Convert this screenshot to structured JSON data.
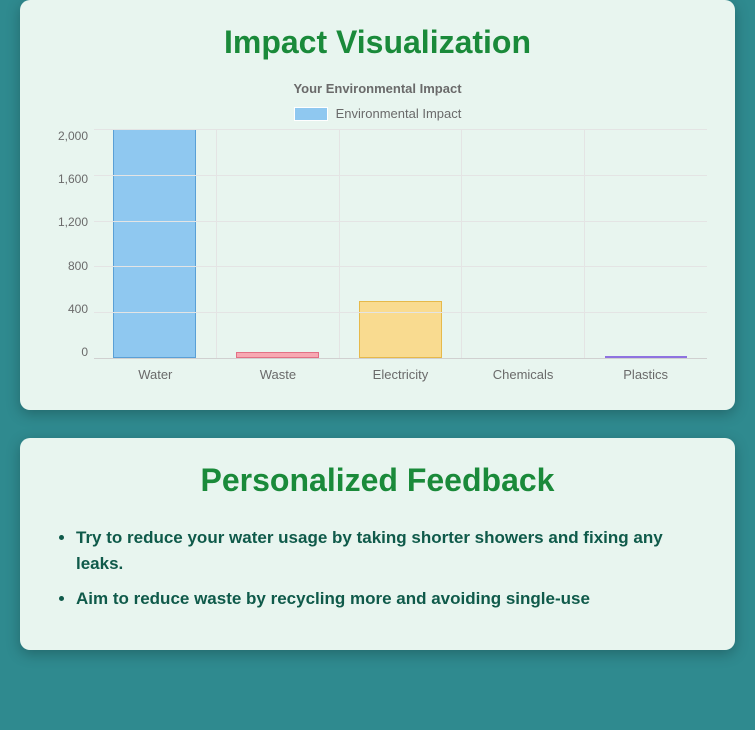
{
  "impact": {
    "heading": "Impact Visualization",
    "chart_title": "Your Environmental Impact",
    "legend_label": "Environmental Impact"
  },
  "chart_data": {
    "type": "bar",
    "title": "Your Environmental Impact",
    "xlabel": "",
    "ylabel": "",
    "ylim": [
      0,
      2000
    ],
    "y_ticks": [
      "2,000",
      "1,600",
      "1,200",
      "800",
      "400",
      "0"
    ],
    "categories": [
      "Water",
      "Waste",
      "Electricity",
      "Chemicals",
      "Plastics"
    ],
    "series": [
      {
        "name": "Environmental Impact",
        "values": [
          2000,
          50,
          500,
          0,
          10
        ],
        "colors": [
          "#8fc8f0",
          "#f7a8b2",
          "#f9db90",
          "#80d9c8",
          "#b9a7f2"
        ],
        "border_colors": [
          "#5aa0d6",
          "#e27085",
          "#e6b94a",
          "#4ebfa6",
          "#8e72e0"
        ]
      }
    ]
  },
  "feedback": {
    "heading": "Personalized Feedback",
    "items": [
      "Try to reduce your water usage by taking shorter showers and fixing any leaks.",
      "Aim to reduce waste by recycling more and avoiding single-use"
    ]
  }
}
